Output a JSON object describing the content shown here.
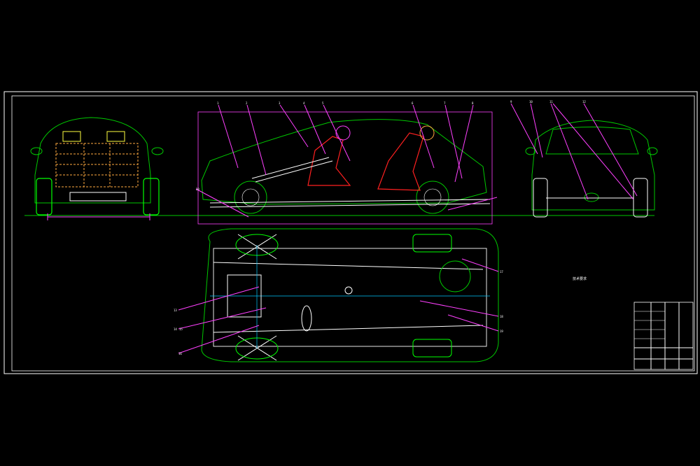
{
  "notes": {
    "title": "技术要求",
    "lines": [
      "",
      "",
      "",
      ""
    ]
  },
  "callouts_top": [
    "1",
    "2",
    "3",
    "4",
    "5",
    "6",
    "7",
    "8",
    "9",
    "10",
    "11",
    "12"
  ],
  "callouts_bottom": [
    "13",
    "14",
    "15",
    "16",
    "17",
    "18",
    "19",
    "20"
  ],
  "title_block": {
    "drawing_name": "",
    "cells": [
      "",
      "",
      "",
      "",
      "",
      ""
    ]
  },
  "colors": {
    "background": "#000000",
    "frame": "#ffffff",
    "body_outline": "#00c800",
    "seat": "#ff2020",
    "magenta": "#ff40ff",
    "cyan": "#00c8ff",
    "yellow": "#ffff40",
    "white": "#ffffff"
  }
}
